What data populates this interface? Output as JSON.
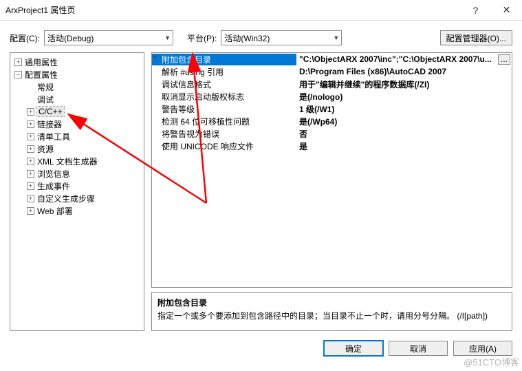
{
  "window": {
    "title": "ArxProject1 属性页",
    "help": "?",
    "close": "✕"
  },
  "toolbar": {
    "config_label": "配置(C):",
    "config_value": "活动(Debug)",
    "platform_label": "平台(P):",
    "platform_value": "活动(Win32)",
    "manager_label": "配置管理器(O)..."
  },
  "tree": [
    {
      "depth": 1,
      "exp": "+",
      "label": "通用属性"
    },
    {
      "depth": 1,
      "exp": "-",
      "label": "配置属性"
    },
    {
      "depth": 2,
      "exp": "",
      "label": "常规"
    },
    {
      "depth": 2,
      "exp": "",
      "label": "调试"
    },
    {
      "depth": 2,
      "exp": "+",
      "label": "C/C++",
      "selected": true
    },
    {
      "depth": 2,
      "exp": "+",
      "label": "链接器"
    },
    {
      "depth": 2,
      "exp": "+",
      "label": "清单工具"
    },
    {
      "depth": 2,
      "exp": "+",
      "label": "资源"
    },
    {
      "depth": 2,
      "exp": "+",
      "label": "XML 文档生成器"
    },
    {
      "depth": 2,
      "exp": "+",
      "label": "浏览信息"
    },
    {
      "depth": 2,
      "exp": "+",
      "label": "生成事件"
    },
    {
      "depth": 2,
      "exp": "+",
      "label": "自定义生成步骤"
    },
    {
      "depth": 2,
      "exp": "+",
      "label": "Web 部署"
    }
  ],
  "grid": [
    {
      "k": "附加包含目录",
      "v": "\"C:\\ObjectARX 2007\\inc\";\"C:\\ObjectARX 2007\\u...",
      "selected": true,
      "dropdown": true,
      "dots": "..."
    },
    {
      "k": "解析 #using 引用",
      "v": "D:\\Program Files (x86)\\AutoCAD 2007"
    },
    {
      "k": "调试信息格式",
      "v": "用于\"编辑并继续\"的程序数据库(/ZI)"
    },
    {
      "k": "取消显示启动版权标志",
      "v": "是(/nologo)"
    },
    {
      "k": "警告等级",
      "v": "1 级(/W1)"
    },
    {
      "k": "检测 64 位可移植性问题",
      "v": "是(/Wp64)"
    },
    {
      "k": "将警告视为错误",
      "v": "否"
    },
    {
      "k": "使用 UNICODE 响应文件",
      "v": "是"
    }
  ],
  "desc": {
    "title": "附加包含目录",
    "body": "指定一个或多个要添加到包含路径中的目录；当目录不止一个时，请用分号分隔。     (/I[path])"
  },
  "footer": {
    "ok": "确定",
    "cancel": "取消",
    "apply": "应用(A)"
  },
  "watermark": "@51CTO博客"
}
